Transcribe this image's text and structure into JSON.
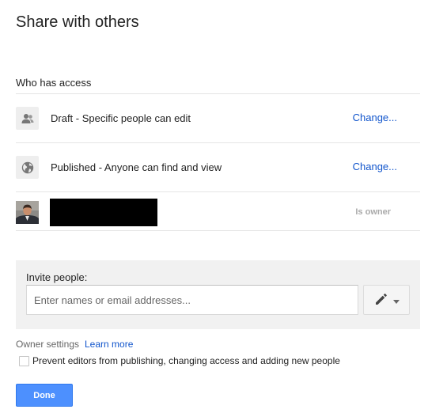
{
  "dialog": {
    "title": "Share with others"
  },
  "access": {
    "heading": "Who has access",
    "items": [
      {
        "icon": "people-icon",
        "label": "Draft - Specific people can edit",
        "action": "Change..."
      },
      {
        "icon": "globe-icon",
        "label": "Published - Anyone can find and view",
        "action": "Change..."
      }
    ],
    "owner": {
      "role": "Is owner"
    }
  },
  "invite": {
    "label": "Invite people:",
    "placeholder": "Enter names or email addresses...",
    "value": "",
    "permission_icon": "pencil-icon"
  },
  "owner_settings": {
    "label": "Owner settings",
    "learn_more": "Learn more",
    "checkbox_label": "Prevent editors from publishing, changing access and adding new people",
    "checkbox_checked": false
  },
  "footer": {
    "done_label": "Done"
  },
  "colors": {
    "link": "#1155cc",
    "primary_button": "#4d90fe",
    "invite_background": "#f1f1f1"
  }
}
